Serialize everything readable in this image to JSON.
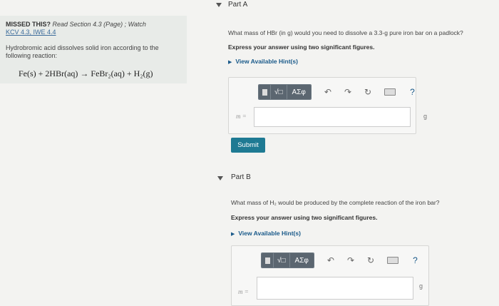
{
  "left": {
    "missed_label": "MISSED THIS?",
    "read_text": "Read Section 4.3 (Page) ; Watch",
    "links": "KCV 4.3, IWE 4.4",
    "description": "Hydrobromic acid dissolves solid iron according to the following reaction:",
    "equation": "Fe(s) + 2HBr(aq) → FeBr₂(aq) + H₂(g)"
  },
  "partA": {
    "title": "Part A",
    "question": "What mass of HBr (in g) would you need to dissolve a 3.3-g pure iron bar on a padlock?",
    "instruction": "Express your answer using two significant figures.",
    "hints": "View Available Hint(s)",
    "var": "m =",
    "unit": "g",
    "submit": "Submit"
  },
  "partB": {
    "title": "Part B",
    "question": "What mass of H₂ would be produced by the complete reaction of the iron bar?",
    "instruction": "Express your answer using two significant figures.",
    "hints": "View Available Hint(s)",
    "var": "m =",
    "unit": "g"
  },
  "toolbar": {
    "greek": "ΑΣφ",
    "root": "√□",
    "help": "?"
  },
  "icons": [
    "matrix-template-icon",
    "undo-icon",
    "redo-icon",
    "reset-icon",
    "keyboard-icon",
    "help-icon"
  ]
}
